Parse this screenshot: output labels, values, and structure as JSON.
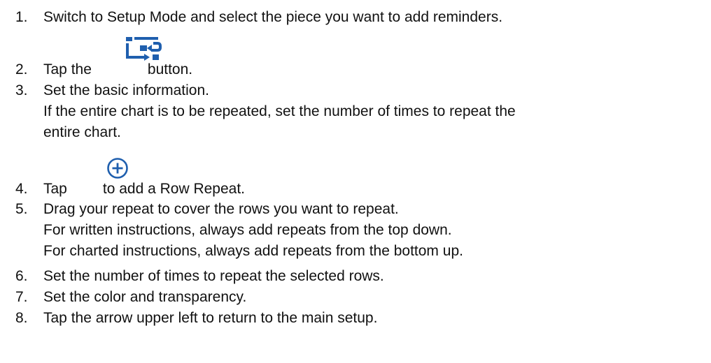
{
  "steps": [
    {
      "num": "1.",
      "text": "Switch to Setup Mode and select the piece you want to add reminders."
    },
    {
      "num": "2.",
      "before": "Tap the",
      "after": "button.",
      "icon": "repeat-setup-icon"
    },
    {
      "num": "3.",
      "text": "Set the basic information.",
      "lines": [
        "If the entire chart is to be repeated, set the number of times to repeat the",
        "entire chart."
      ]
    },
    {
      "num": "4.",
      "before": "Tap",
      "after": "to add a Row Repeat.",
      "icon": "add-circle-icon"
    },
    {
      "num": "5.",
      "text": "Drag your repeat to cover the rows you want to repeat.",
      "lines": [
        "For written instructions, always add repeats from the top down.",
        "For charted instructions, always add repeats from the bottom up."
      ]
    },
    {
      "num": "6.",
      "text": "Set the number of times to repeat the selected rows."
    },
    {
      "num": "7.",
      "text": "Set the color and transparency."
    },
    {
      "num": "8.",
      "text": "Tap the arrow upper left to return to the main setup."
    }
  ],
  "colors": {
    "icon": "#1f5fae",
    "text": "#111111"
  }
}
